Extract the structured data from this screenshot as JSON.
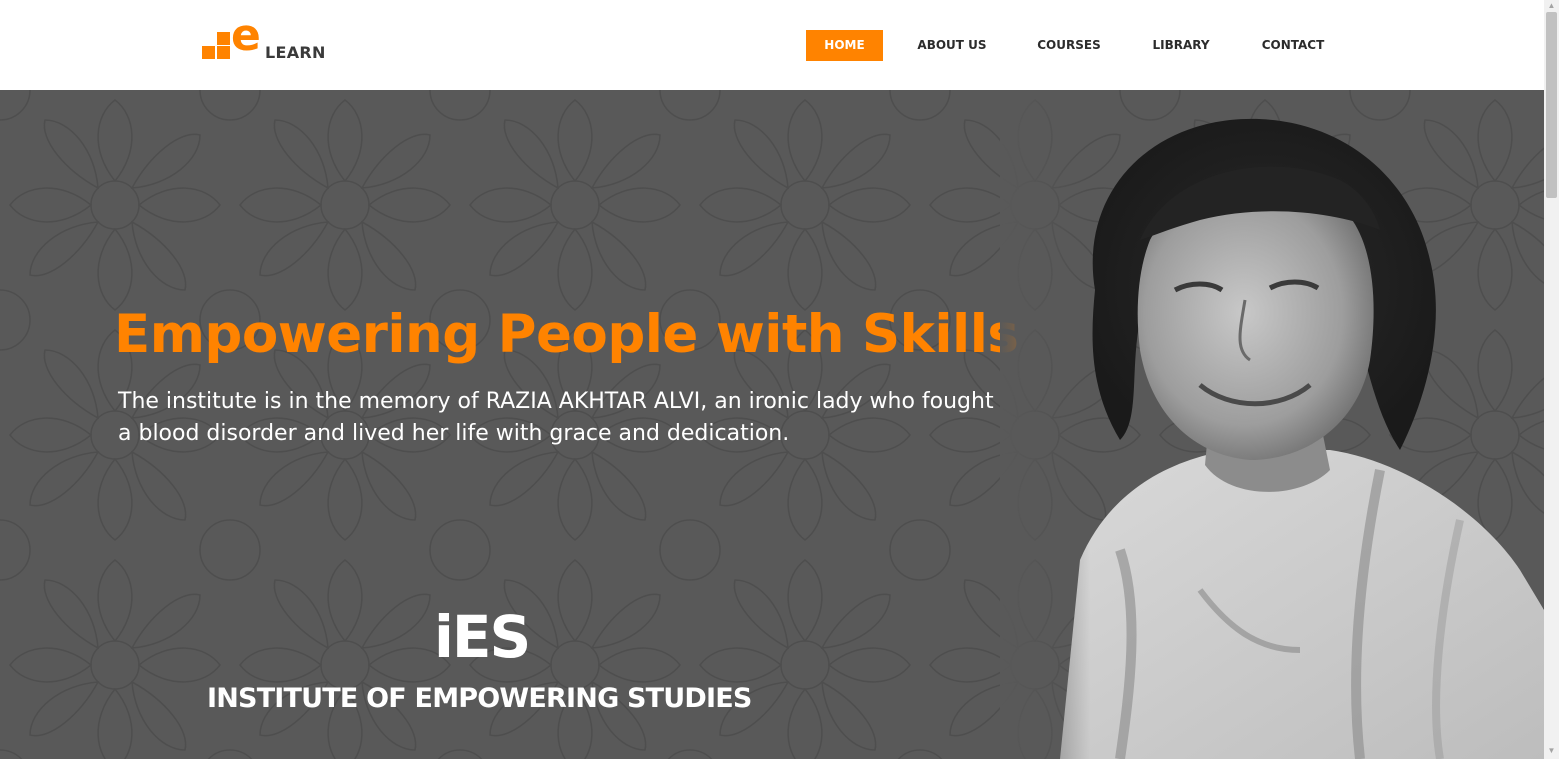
{
  "brand": {
    "logo_letter": "e",
    "logo_text": "LEARN",
    "accent_color": "#ff8300"
  },
  "nav": {
    "items": [
      {
        "label": "HOME",
        "active": true
      },
      {
        "label": "ABOUT US",
        "active": false
      },
      {
        "label": "COURSES",
        "active": false
      },
      {
        "label": "LIBRARY",
        "active": false
      },
      {
        "label": "CONTACT",
        "active": false
      }
    ]
  },
  "hero": {
    "title": "Empowering People with Skills",
    "text": "The institute is in the memory of RAZIA AKHTAR ALVI, an ironic lady who fought a blood disorder and lived her life with grace and dedication.",
    "ies_brand": "iES",
    "ies_name": "INSTITUTE OF EMPOWERING STUDIES",
    "background_color": "#595959",
    "title_color": "#ff8300"
  },
  "scrollbar": {
    "up_arrow": "▲",
    "down_arrow": "▼"
  }
}
